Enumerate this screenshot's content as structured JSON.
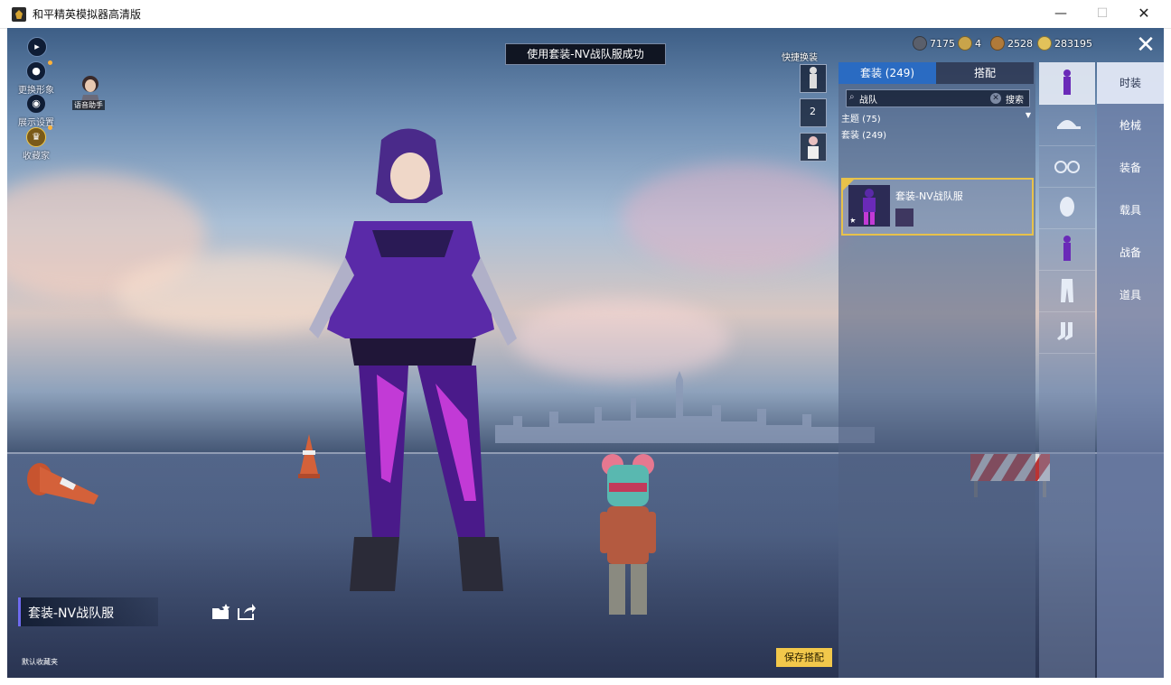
{
  "window": {
    "title": "和平精英模拟器高清版",
    "min": "—",
    "max": "☐",
    "close": "✕"
  },
  "hud": {
    "change_look": "更换形象",
    "display_settings": "展示设置",
    "collector": "收藏家",
    "voice_assistant": "语音助手"
  },
  "toast": "使用套装-NV战队服成功",
  "currencies": [
    {
      "amount": "7175",
      "color": "#5a5f6b"
    },
    {
      "amount": "4",
      "color": "#c9a44a"
    },
    {
      "amount": "2528",
      "color": "#b07a3a"
    },
    {
      "amount": "283195",
      "color": "#e2c25a"
    }
  ],
  "close_button": "✕",
  "quick_change": {
    "label": "快捷换装",
    "slot2_number": "2"
  },
  "panel": {
    "tab_outfits": "套装 (249)",
    "tab_match": "搭配",
    "search_value": "战队",
    "search_button": "搜索",
    "theme_filter": "主题 (75)",
    "outfit_count": "套装 (249)",
    "item_name": "套装-NV战队服"
  },
  "menu": [
    "时装",
    "枪械",
    "装备",
    "载具",
    "战备",
    "道具"
  ],
  "outfit_label": "套装-NV战队服",
  "default_favorite": "默认收藏夹",
  "save_button": "保存搭配"
}
